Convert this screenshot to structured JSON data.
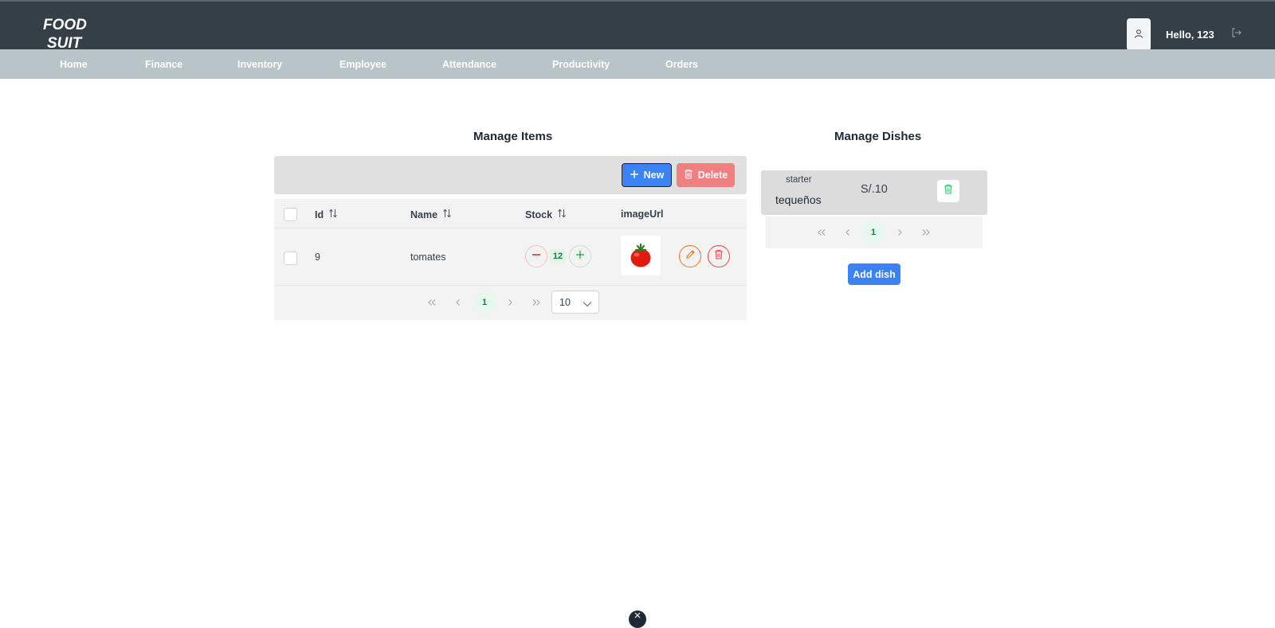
{
  "header": {
    "logo_line1": "FOOD",
    "logo_line2": "SUIT",
    "greeting": "Hello, 123",
    "user_icon": "user-icon",
    "logout_icon": "logout-icon"
  },
  "nav": {
    "items": [
      "Home",
      "Finance",
      "Inventory",
      "Employee",
      "Attendance",
      "Productivity",
      "Orders"
    ]
  },
  "items_panel": {
    "title": "Manage Items",
    "toolbar": {
      "new_label": "New",
      "delete_label": "Delete"
    },
    "columns": [
      "Id",
      "Name",
      "Stock",
      "imageUrl"
    ],
    "rows": [
      {
        "id": "9",
        "name": "tomates",
        "stock": "12",
        "image": "tomato-image"
      }
    ],
    "pager": {
      "current_page": "1",
      "rows_per_page": "10"
    }
  },
  "dishes_panel": {
    "title": "Manage Dishes",
    "dishes": [
      {
        "category": "starter",
        "name": "tequeños",
        "price": "S/.10"
      }
    ],
    "pager": {
      "current_page": "1"
    },
    "add_label": "Add dish"
  },
  "colors": {
    "topbar": "#343f47",
    "navbar": "#b8c4c8",
    "primary": "#3b82f6",
    "danger": "#f08080",
    "success": "#15803d"
  }
}
